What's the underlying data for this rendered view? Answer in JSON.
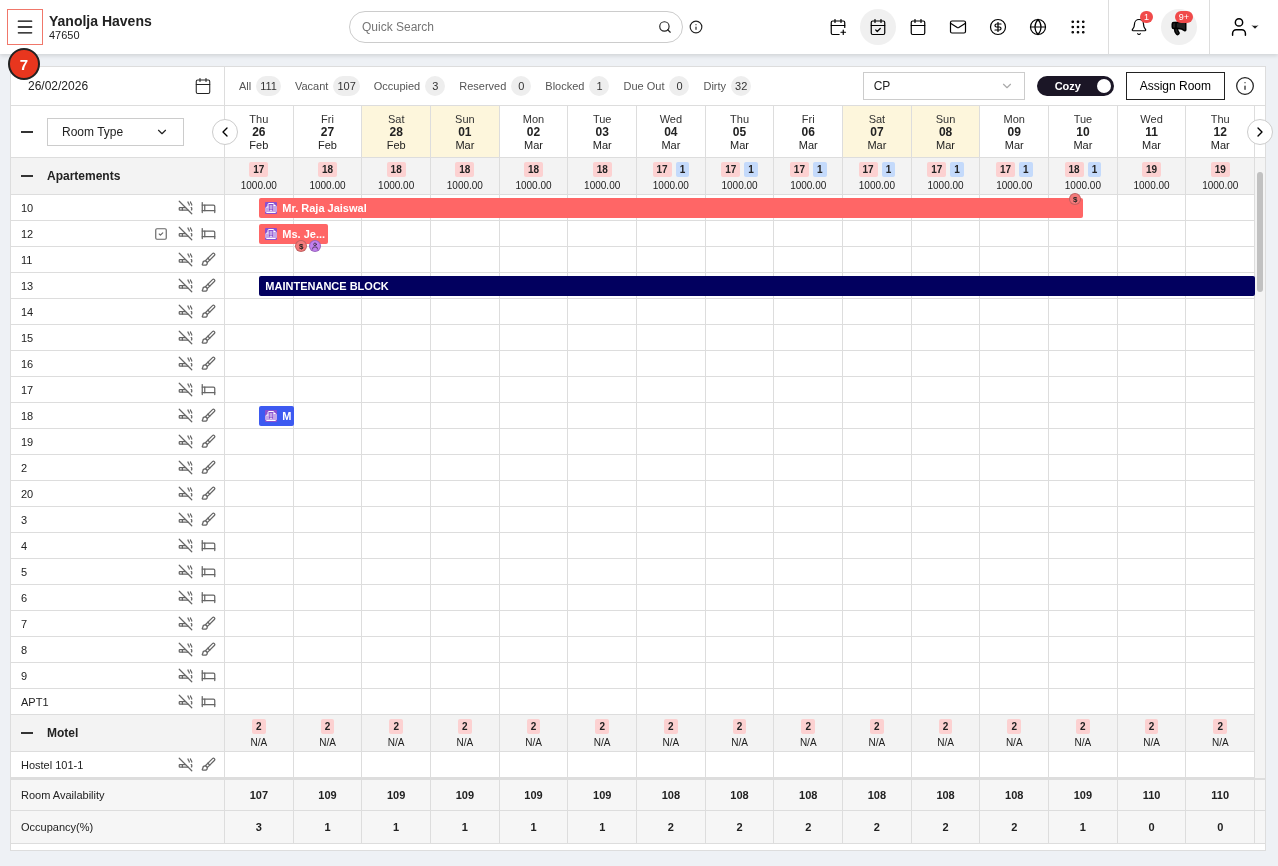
{
  "header": {
    "menu_highlighted": true,
    "tour_step": "7",
    "property_name": "Yanolja Havens",
    "property_id": "47650",
    "search": {
      "placeholder": "Quick Search"
    },
    "toolbar": [
      {
        "kind": "calendar-plus",
        "selected": false
      },
      {
        "kind": "calendar-check",
        "selected": true
      },
      {
        "kind": "calendar",
        "selected": false
      },
      {
        "kind": "mail",
        "selected": false
      },
      {
        "kind": "dollar",
        "selected": false
      },
      {
        "kind": "globe",
        "selected": false
      },
      {
        "kind": "apps",
        "selected": false
      }
    ],
    "notifications": {
      "count": "1"
    },
    "announcements": {
      "count": "9+"
    }
  },
  "filter_bar": {
    "date": "26/02/2026",
    "filters": [
      {
        "label": "All",
        "count": "111"
      },
      {
        "label": "Vacant",
        "count": "107"
      },
      {
        "label": "Occupied",
        "count": "3"
      },
      {
        "label": "Reserved",
        "count": "0"
      },
      {
        "label": "Blocked",
        "count": "1"
      },
      {
        "label": "Due Out",
        "count": "0"
      },
      {
        "label": "Dirty",
        "count": "32"
      }
    ],
    "rate_plan": "CP",
    "view_toggle": {
      "label": "Cozy",
      "on": true
    },
    "assign_button": "Assign Room"
  },
  "grid": {
    "group_by": "Room Type",
    "days": [
      {
        "dow": "Thu",
        "day": "26",
        "month": "Feb",
        "weekend": false
      },
      {
        "dow": "Fri",
        "day": "27",
        "month": "Feb",
        "weekend": false
      },
      {
        "dow": "Sat",
        "day": "28",
        "month": "Feb",
        "weekend": true
      },
      {
        "dow": "Sun",
        "day": "01",
        "month": "Mar",
        "weekend": true
      },
      {
        "dow": "Mon",
        "day": "02",
        "month": "Mar",
        "weekend": false
      },
      {
        "dow": "Tue",
        "day": "03",
        "month": "Mar",
        "weekend": false
      },
      {
        "dow": "Wed",
        "day": "04",
        "month": "Mar",
        "weekend": false
      },
      {
        "dow": "Thu",
        "day": "05",
        "month": "Mar",
        "weekend": false
      },
      {
        "dow": "Fri",
        "day": "06",
        "month": "Mar",
        "weekend": false
      },
      {
        "dow": "Sat",
        "day": "07",
        "month": "Mar",
        "weekend": true
      },
      {
        "dow": "Sun",
        "day": "08",
        "month": "Mar",
        "weekend": true
      },
      {
        "dow": "Mon",
        "day": "09",
        "month": "Mar",
        "weekend": false
      },
      {
        "dow": "Tue",
        "day": "10",
        "month": "Mar",
        "weekend": false
      },
      {
        "dow": "Wed",
        "day": "11",
        "month": "Mar",
        "weekend": false
      },
      {
        "dow": "Thu",
        "day": "12",
        "month": "Mar",
        "weekend": false
      }
    ],
    "groups": [
      {
        "name": "Apartements",
        "expanded": true,
        "cells": [
          {
            "available": "17",
            "rate": "1000.00"
          },
          {
            "available": "18",
            "rate": "1000.00"
          },
          {
            "available": "18",
            "rate": "1000.00"
          },
          {
            "available": "18",
            "rate": "1000.00"
          },
          {
            "available": "18",
            "rate": "1000.00"
          },
          {
            "available": "18",
            "rate": "1000.00"
          },
          {
            "available": "17",
            "blocked": "1",
            "rate": "1000.00"
          },
          {
            "available": "17",
            "blocked": "1",
            "rate": "1000.00"
          },
          {
            "available": "17",
            "blocked": "1",
            "rate": "1000.00"
          },
          {
            "available": "17",
            "blocked": "1",
            "rate": "1000.00"
          },
          {
            "available": "17",
            "blocked": "1",
            "rate": "1000.00"
          },
          {
            "available": "17",
            "blocked": "1",
            "rate": "1000.00"
          },
          {
            "available": "18",
            "blocked": "1",
            "rate": "1000.00"
          },
          {
            "available": "19",
            "rate": "1000.00"
          },
          {
            "available": "19",
            "rate": "1000.00"
          }
        ],
        "rooms": [
          {
            "name": "10",
            "clean": true,
            "task": false,
            "bookings": [
              {
                "kind": "guest",
                "label": "Mr. Raja Jaiswal",
                "color": "#ff6666",
                "badges": [
                  {
                    "kind": "payment",
                    "text": "$"
                  }
                ]
              }
            ]
          },
          {
            "name": "12",
            "clean": true,
            "task": true,
            "bookings": [
              {
                "kind": "guest",
                "label": "Ms. Je...",
                "color": "#ff6666",
                "badges": [
                  {
                    "kind": "payment",
                    "text": "$"
                  },
                  {
                    "kind": "guest"
                  }
                ]
              }
            ]
          },
          {
            "name": "11",
            "clean": false,
            "task": false
          },
          {
            "name": "13",
            "clean": false,
            "task": false,
            "bookings": [
              {
                "kind": "block",
                "label": "MAINTENANCE BLOCK",
                "color": "#02005f"
              }
            ]
          },
          {
            "name": "14",
            "clean": false,
            "task": false
          },
          {
            "name": "15",
            "clean": false,
            "task": false
          },
          {
            "name": "16",
            "clean": false,
            "task": false
          },
          {
            "name": "17",
            "clean": true,
            "task": false
          },
          {
            "name": "18",
            "clean": false,
            "task": false,
            "bookings": [
              {
                "kind": "guest",
                "label": "M",
                "color": "#3d5af1"
              }
            ]
          },
          {
            "name": "19",
            "clean": false,
            "task": false
          },
          {
            "name": "2",
            "clean": false,
            "task": false
          },
          {
            "name": "20",
            "clean": false,
            "task": false
          },
          {
            "name": "3",
            "clean": false,
            "task": false
          },
          {
            "name": "4",
            "clean": true,
            "task": false
          },
          {
            "name": "5",
            "clean": true,
            "task": false
          },
          {
            "name": "6",
            "clean": true,
            "task": false
          },
          {
            "name": "7",
            "clean": false,
            "task": false
          },
          {
            "name": "8",
            "clean": false,
            "task": false
          },
          {
            "name": "9",
            "clean": true,
            "task": false
          },
          {
            "name": "APT1",
            "clean": true,
            "task": false
          }
        ]
      },
      {
        "name": "Motel",
        "expanded": true,
        "cells": [
          {
            "available": "2",
            "rate": "N/A"
          },
          {
            "available": "2",
            "rate": "N/A"
          },
          {
            "available": "2",
            "rate": "N/A"
          },
          {
            "available": "2",
            "rate": "N/A"
          },
          {
            "available": "2",
            "rate": "N/A"
          },
          {
            "available": "2",
            "rate": "N/A"
          },
          {
            "available": "2",
            "rate": "N/A"
          },
          {
            "available": "2",
            "rate": "N/A"
          },
          {
            "available": "2",
            "rate": "N/A"
          },
          {
            "available": "2",
            "rate": "N/A"
          },
          {
            "available": "2",
            "rate": "N/A"
          },
          {
            "available": "2",
            "rate": "N/A"
          },
          {
            "available": "2",
            "rate": "N/A"
          },
          {
            "available": "2",
            "rate": "N/A"
          },
          {
            "available": "2",
            "rate": "N/A"
          }
        ],
        "rooms": [
          {
            "name": "Hostel 101-1",
            "clean": false,
            "task": false
          }
        ]
      }
    ],
    "summary": [
      {
        "label": "Room Availability",
        "values": [
          "107",
          "109",
          "109",
          "109",
          "109",
          "109",
          "108",
          "108",
          "108",
          "108",
          "108",
          "108",
          "109",
          "110",
          "110"
        ]
      },
      {
        "label": "Occupancy(%)",
        "values": [
          "3",
          "1",
          "1",
          "1",
          "1",
          "1",
          "2",
          "2",
          "2",
          "2",
          "2",
          "2",
          "1",
          "0",
          "0"
        ]
      }
    ]
  }
}
